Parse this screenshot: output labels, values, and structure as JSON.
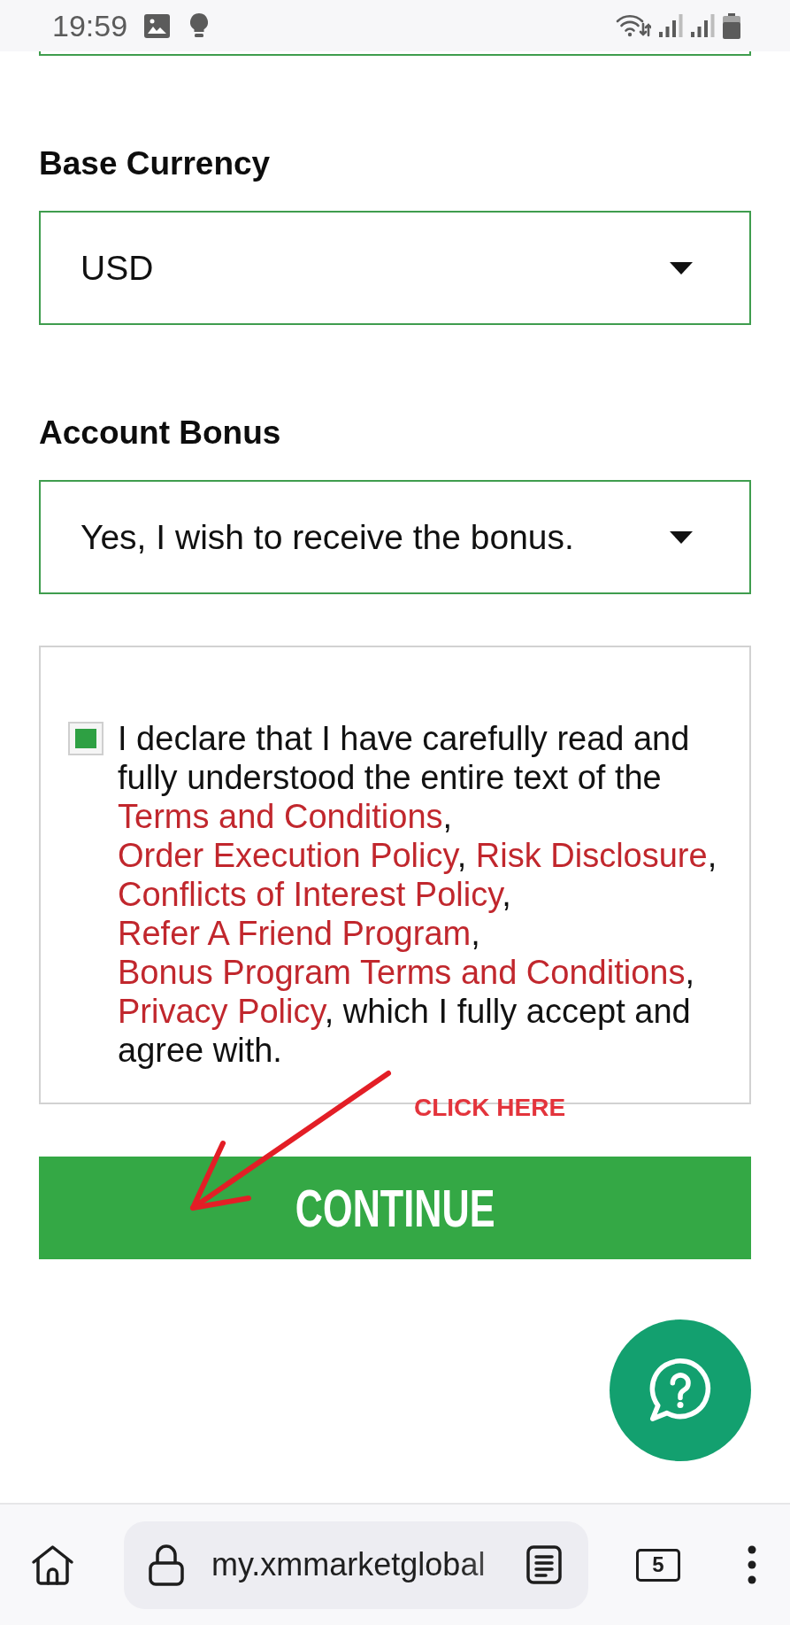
{
  "status_bar": {
    "time": "19:59"
  },
  "form": {
    "fields": [
      {
        "label": "Base Currency",
        "value": "USD"
      },
      {
        "label": "Account Bonus",
        "value": "Yes, I wish to receive the bonus."
      }
    ],
    "declaration": {
      "checked": true,
      "segments": [
        {
          "kind": "text",
          "text": "I declare that I have carefully read and fully understood the entire text of the "
        },
        {
          "kind": "link",
          "text": "Terms and Conditions"
        },
        {
          "kind": "text",
          "text": ", "
        },
        {
          "kind": "link",
          "text": "Order Execution Policy"
        },
        {
          "kind": "text",
          "text": ", "
        },
        {
          "kind": "link",
          "text": "Risk Disclosure"
        },
        {
          "kind": "text",
          "text": ", "
        },
        {
          "kind": "link",
          "text": "Conflicts of Interest Policy"
        },
        {
          "kind": "text",
          "text": ", "
        },
        {
          "kind": "link",
          "text": "Refer A Friend Program"
        },
        {
          "kind": "text",
          "text": ", "
        },
        {
          "kind": "link",
          "text": "Bonus Program Terms and Conditions"
        },
        {
          "kind": "text",
          "text": ", "
        },
        {
          "kind": "link",
          "text": "Privacy Policy"
        },
        {
          "kind": "text",
          "text": ", which I fully accept and agree with."
        }
      ]
    },
    "continue_button": {
      "label": "CONTINUE"
    }
  },
  "annotation": {
    "label": "CLICK HERE"
  },
  "browser_bar": {
    "url": "my.xmmarketglobal",
    "tab_count": "5"
  }
}
